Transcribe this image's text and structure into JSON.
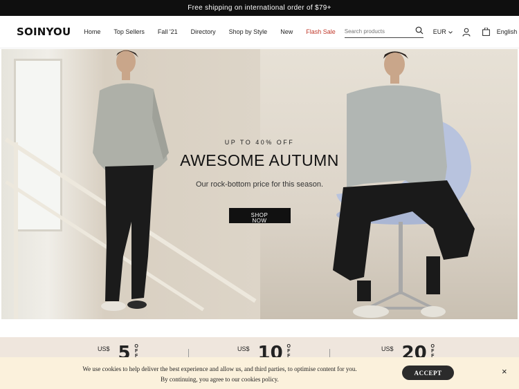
{
  "announcement": "Free shipping on international order of $79+",
  "header": {
    "logo": "SOINYOU",
    "nav": [
      "Home",
      "Top Sellers",
      "Fall '21",
      "Directory",
      "Shop by Style",
      "New",
      "Flash Sale"
    ],
    "search_placeholder": "Search products",
    "currency": "EUR",
    "language": "English"
  },
  "hero": {
    "kicker": "UP TO 40% OFF",
    "title": "AWESOME AUTUMN",
    "subtitle": "Our rock-bottom price for this season.",
    "cta": "SHOP NOW"
  },
  "promo": {
    "coupons": [
      {
        "currency": "US$",
        "amount": "5",
        "off": "OFF"
      },
      {
        "currency": "US$",
        "amount": "10",
        "off": "OFF"
      },
      {
        "currency": "US$",
        "amount": "20",
        "off": "OFF"
      }
    ]
  },
  "cookie": {
    "line1": "We use cookies to help deliver the best experience and allow us, and third parties, to optimise content for you.",
    "line2": "By continuing, you agree to our cookies policy.",
    "accept": "ACCEPT",
    "close": "×"
  },
  "icons": {
    "search": "search-icon",
    "account": "user-icon",
    "cart": "bag-icon",
    "close": "close-icon"
  },
  "colors": {
    "flash_sale": "#c0392b",
    "topbar_bg": "#0f0f0f",
    "promo_bg": "#efe6dd",
    "cookie_bg": "#fbf1dc"
  }
}
